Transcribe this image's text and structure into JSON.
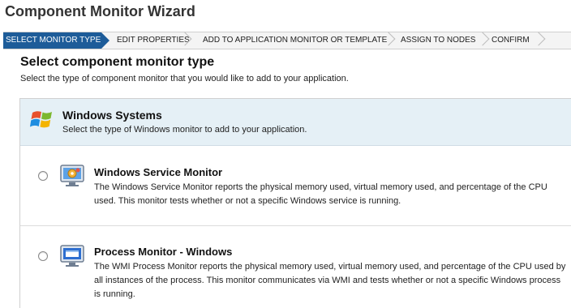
{
  "window": {
    "title": "Component Monitor Wizard"
  },
  "wizard_steps": [
    {
      "label": "SELECT MONITOR TYPE",
      "active": true
    },
    {
      "label": "EDIT PROPERTIES",
      "active": false
    },
    {
      "label": "ADD TO APPLICATION MONITOR OR TEMPLATE",
      "active": false
    },
    {
      "label": "ASSIGN TO NODES",
      "active": false
    },
    {
      "label": "CONFIRM",
      "active": false
    }
  ],
  "section": {
    "title": "Select component monitor type",
    "subtitle": "Select the type of component monitor that you would like to add to your application."
  },
  "group": {
    "icon": "windows-logo-icon",
    "title": "Windows Systems",
    "description": "Select the type of Windows monitor to add to your application."
  },
  "monitors": [
    {
      "icon": "service-monitor-icon",
      "title": "Windows Service Monitor",
      "description": "The Windows Service Monitor reports the physical memory used, virtual memory used, and percentage of the CPU used. This monitor tests whether or not a specific Windows service is running.",
      "selected": false
    },
    {
      "icon": "process-monitor-icon",
      "title": "Process Monitor - Windows",
      "description": "The WMI Process Monitor reports the physical memory used, virtual memory used, and percentage of the CPU used by all instances of the process. This monitor communicates via WMI and tests whether or not a specific Windows process is running.",
      "selected": false
    }
  ],
  "colors": {
    "active_step": "#1d5c99",
    "group_header": "#e5f0f6"
  }
}
